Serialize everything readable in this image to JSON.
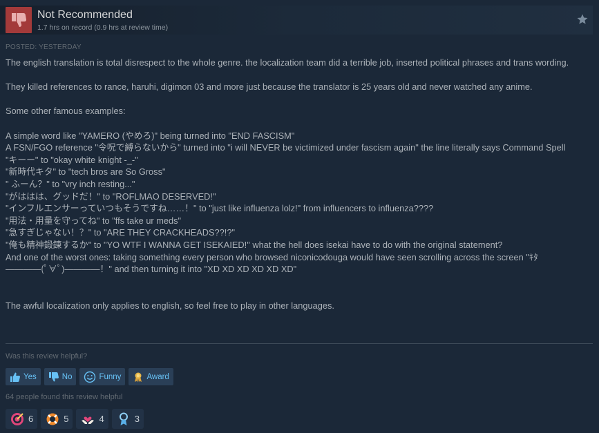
{
  "header": {
    "verdict": "Not Recommended",
    "hours": "1.7 hrs on record (0.9 hrs at review time)"
  },
  "posted": "POSTED: YESTERDAY",
  "review_lines": [
    "The english translation is total disrespect to the whole genre. the localization team did a terrible job, inserted political phrases and trans wording.",
    "",
    "They killed references to rance, haruhi, digimon 03 and more just because the translator is 25 years old and never watched any anime.",
    "",
    "Some other famous examples:",
    "",
    "A simple word like \"YAMERO (やめろ)\" being turned into \"END FASCISM\"",
    "A FSN/FGO reference \"令呪で縛らないから\" turned into \"i will NEVER be victimized under fascism again\" the line literally says Command Spell",
    "\"キーー\" to \"okay white knight -_-\"",
    "\"新時代キタ\" to \"tech bros are So Gross\"",
    "\" ふーん？\" to \"vry inch resting...\"",
    "\"がははは、グッドだ！\" to \"ROFLMAO DESERVED!\"",
    "\"インフルエンサーっていつもそうですね……！\" to \"just like influenza lolz!\" from influencers to influenza????",
    "\"用法・用量を守ってね\" to \"ffs take ur meds\"",
    "\"急すぎじゃない！？\" to \"ARE THEY CRACKHEADS??!?\"",
    "\"俺も精神鍛錬するか\" to \"YO WTF I WANNA GET ISEKAIED!\" what the hell does isekai have to do with the original statement?",
    "And one of the worst ones: taking something every person who browsed niconicodouga would have seen scrolling across the screen \"ｷﾀ――――(ﾟ∀ﾟ)――――！\" and then turning it into \"XD XD XD XD XD XD\"",
    "",
    "",
    "The awful localization only applies to english, so feel free to play in other languages."
  ],
  "helpful_question": "Was this review helpful?",
  "buttons": {
    "yes": "Yes",
    "no": "No",
    "funny": "Funny",
    "award": "Award"
  },
  "found_helpful": "64 people found this review helpful",
  "awards": [
    {
      "icon": "target-award-icon",
      "count": "6"
    },
    {
      "icon": "lifebuoy-award-icon",
      "count": "5"
    },
    {
      "icon": "hands-heart-award-icon",
      "count": "4"
    },
    {
      "icon": "medal-award-icon",
      "count": "3"
    }
  ],
  "colors": {
    "background": "#1b2838",
    "thumb_down": "#a33a3a",
    "link_blue": "#67c1f5",
    "button_bg": "#2a3f57"
  }
}
